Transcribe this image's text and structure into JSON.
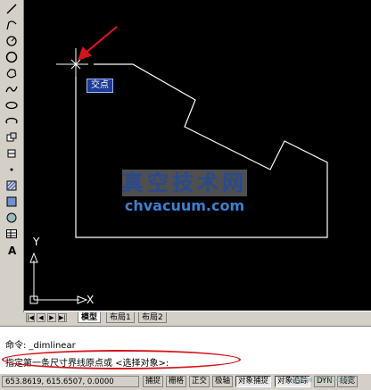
{
  "canvas": {
    "snap_label": "交点",
    "watermark_title": "真空技术网",
    "watermark_url": "chvacuum.com",
    "axis_y": "Y",
    "axis_x": "X"
  },
  "tabs": {
    "nav": [
      "|◀",
      "◀",
      "▶",
      "▶|"
    ],
    "items": [
      {
        "label": "模型",
        "active": true
      },
      {
        "label": "布局1",
        "active": false
      },
      {
        "label": "布局2",
        "active": false
      }
    ]
  },
  "command": {
    "line1": "命令: _dimlinear",
    "line2": "指定第一条尺寸界线原点或 <选择对象>:"
  },
  "status": {
    "coords": "653.8619, 615.6507, 0.0000",
    "buttons": [
      {
        "label": "捕捉",
        "on": false
      },
      {
        "label": "栅格",
        "on": false
      },
      {
        "label": "正交",
        "on": false
      },
      {
        "label": "极轴",
        "on": false
      },
      {
        "label": "对象捕捉",
        "on": true
      },
      {
        "label": "对象追踪",
        "on": true
      },
      {
        "label": "DYN",
        "on": false
      },
      {
        "label": "线宽",
        "on": false
      }
    ],
    "watermark": "www.1CS.com"
  },
  "colors": {
    "canvas_bg": "#000000",
    "geometry": "#ffffff",
    "annotation": "#d4141c",
    "snap_label_bg": "#1e3c96"
  },
  "toolbar_icons": [
    "line-icon",
    "polyline-icon",
    "arc-icon",
    "circle-icon",
    "revision-cloud-icon",
    "spline-icon",
    "ellipse-icon",
    "ellipse-arc-icon",
    "insert-block-icon",
    "make-block-icon",
    "point-icon",
    "hatch-icon",
    "gradient-icon",
    "region-icon",
    "table-icon",
    "text-icon"
  ]
}
